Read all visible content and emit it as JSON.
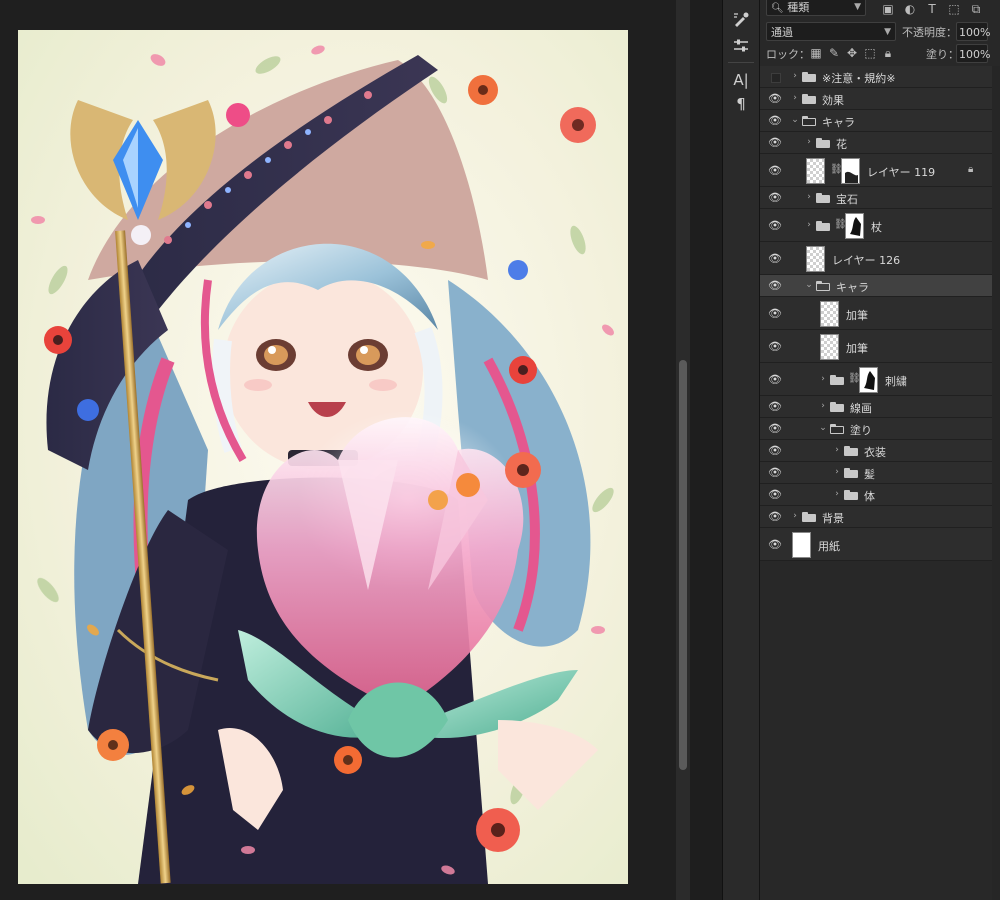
{
  "panel": {
    "filter": {
      "label": "種類",
      "search_icon": "search-icon"
    },
    "blend_mode": "通過",
    "opacity_label": "不透明度：",
    "opacity_value": "100%",
    "lock_label": "ロック：",
    "fill_label": "塗り：",
    "fill_value": "100%"
  },
  "tools": [
    {
      "icon": "brush-settings-icon"
    },
    {
      "icon": "adjustments-icon"
    },
    {
      "icon": "character-icon",
      "glyph": "A|"
    },
    {
      "icon": "paragraph-icon",
      "glyph": "¶"
    }
  ],
  "layers": [
    {
      "name": "※注意・規約※",
      "type": "group",
      "visible": false,
      "indent": 0,
      "expanded": false
    },
    {
      "name": "効果",
      "type": "group",
      "visible": true,
      "indent": 0,
      "expanded": false
    },
    {
      "name": "キャラ",
      "type": "group",
      "visible": true,
      "indent": 0,
      "expanded": true
    },
    {
      "name": "花",
      "type": "group",
      "visible": true,
      "indent": 1,
      "expanded": false
    },
    {
      "name": "レイヤー 119",
      "type": "layer",
      "visible": true,
      "indent": 1,
      "mask": true,
      "locked": true
    },
    {
      "name": "宝石",
      "type": "group",
      "visible": true,
      "indent": 1,
      "expanded": false
    },
    {
      "name": "杖",
      "type": "group",
      "visible": true,
      "indent": 1,
      "expanded": false,
      "mask": true
    },
    {
      "name": "レイヤー 126",
      "type": "layer",
      "visible": true,
      "indent": 1
    },
    {
      "name": "キャラ",
      "type": "group",
      "visible": true,
      "indent": 1,
      "expanded": true,
      "selected": true
    },
    {
      "name": "加筆",
      "type": "layer",
      "visible": true,
      "indent": 2
    },
    {
      "name": "加筆",
      "type": "layer",
      "visible": true,
      "indent": 2
    },
    {
      "name": "刺繍",
      "type": "group",
      "visible": true,
      "indent": 2,
      "expanded": false,
      "mask": true
    },
    {
      "name": "線画",
      "type": "group",
      "visible": true,
      "indent": 2,
      "expanded": false
    },
    {
      "name": "塗り",
      "type": "group",
      "visible": true,
      "indent": 2,
      "expanded": true
    },
    {
      "name": "衣装",
      "type": "group",
      "visible": true,
      "indent": 3,
      "expanded": false
    },
    {
      "name": "髪",
      "type": "group",
      "visible": true,
      "indent": 3,
      "expanded": false
    },
    {
      "name": "体",
      "type": "group",
      "visible": true,
      "indent": 3,
      "expanded": false
    },
    {
      "name": "背景",
      "type": "group",
      "visible": true,
      "indent": 0,
      "expanded": false
    },
    {
      "name": "用紙",
      "type": "paper",
      "visible": true,
      "indent": 0
    }
  ],
  "colors": {
    "panel_bg": "#282828",
    "row_bg": "#2d2d2d",
    "row_selected": "#414141",
    "workspace_bg": "#1f1f1f"
  }
}
